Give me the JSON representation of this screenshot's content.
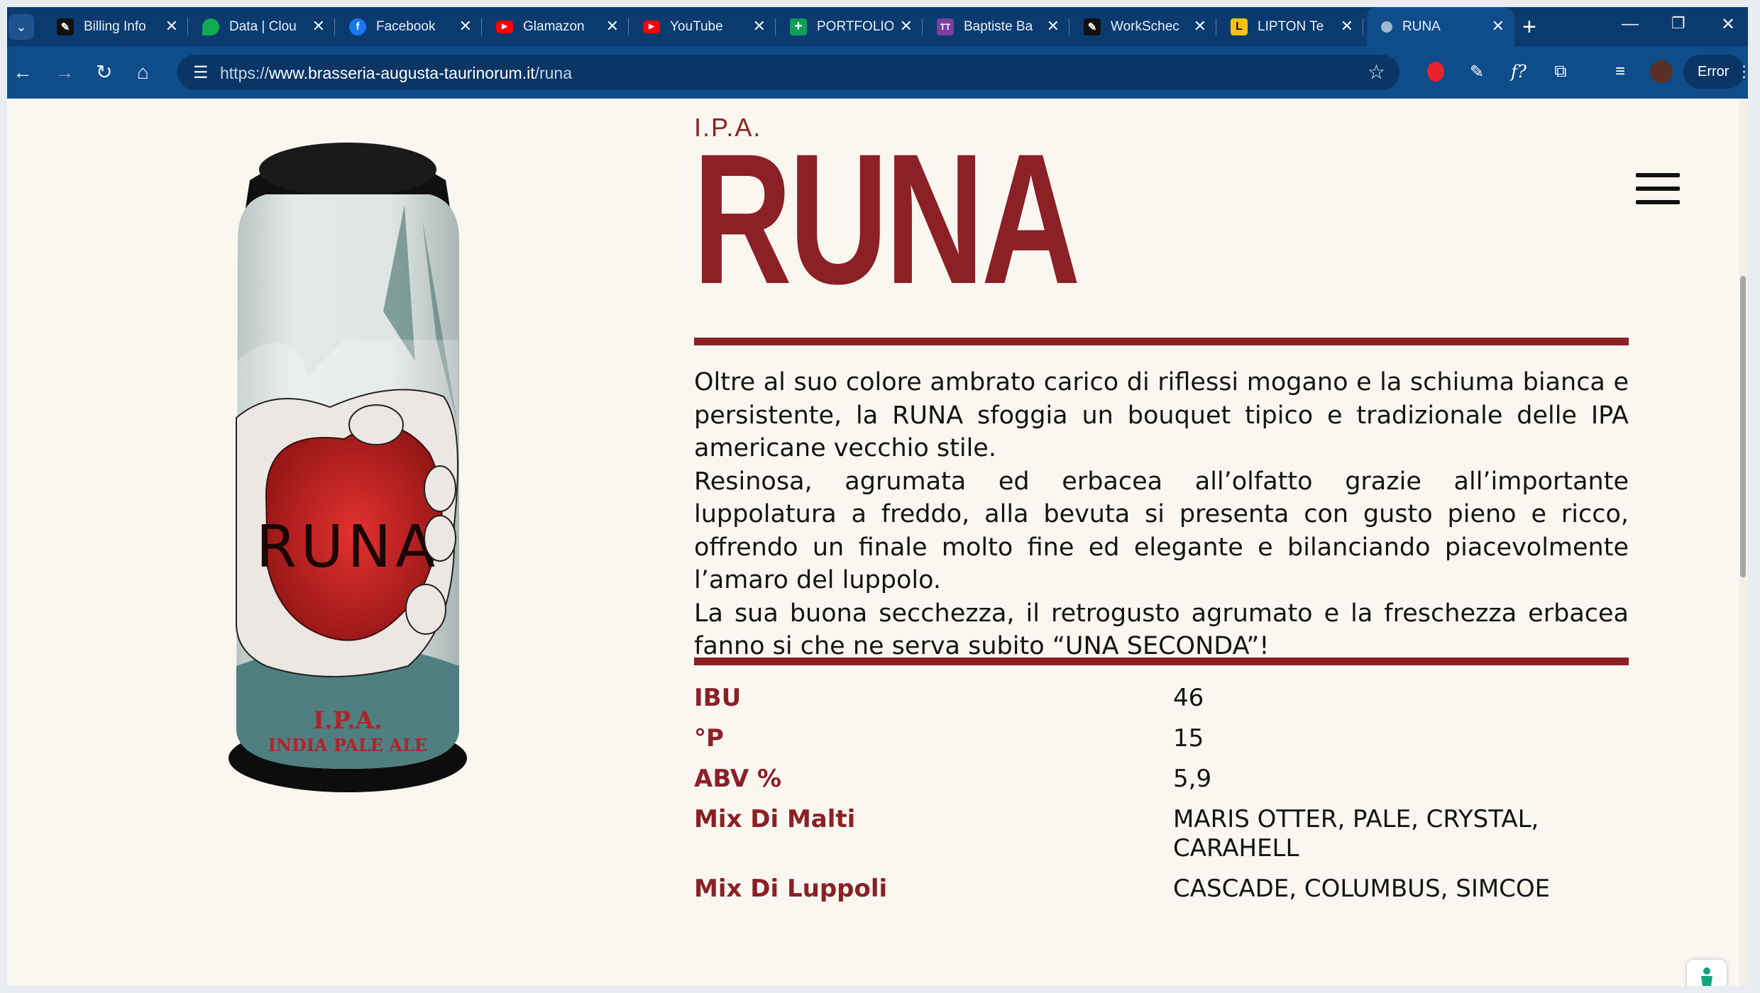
{
  "browser": {
    "tabs": [
      {
        "label": "Billing Info",
        "icon": "squarespace-icon",
        "color": "#111111"
      },
      {
        "label": "Data | Clou",
        "icon": "mongodb-leaf-icon",
        "color": "#13aa52"
      },
      {
        "label": "Facebook",
        "icon": "facebook-icon",
        "color": "#1877f2"
      },
      {
        "label": "Glamazon",
        "icon": "youtube-icon",
        "color": "#ff0000"
      },
      {
        "label": "YouTube",
        "icon": "youtube-icon",
        "color": "#ff0000"
      },
      {
        "label": "PORTFOLIO",
        "icon": "sheets-icon",
        "color": "#0f9d58"
      },
      {
        "label": "Baptiste Ba",
        "icon": "tt-icon",
        "color": "#7b3fa0"
      },
      {
        "label": "WorkSchec",
        "icon": "squarespace-icon",
        "color": "#111111"
      },
      {
        "label": "LIPTON Te",
        "icon": "lipton-icon",
        "color": "#f4c20d"
      },
      {
        "label": "RUNA",
        "icon": "site-icon",
        "color": "#9fb6d1",
        "active": true
      }
    ],
    "url_prefix": "https://",
    "url_host": "www.brasseria-augusta-taurinorum.it",
    "url_path": "/runa",
    "error_label": "Error"
  },
  "page": {
    "type_label": "I.P.A.",
    "beer_name": "RUNA",
    "description": [
      "Oltre al suo colore ambrato carico di riflessi mogano e la schiuma bianca e persistente, la RUNA sfoggia un bouquet tipico e tradizionale delle IPA americane vecchio stile.",
      "Resinosa, agrumata ed erbacea all’olfatto grazie all’importante luppolatura a freddo, alla bevuta si presenta con gusto pieno e ricco, offrendo un finale molto fine ed elegante e bilanciando piacevolmente l’amaro del luppolo.",
      "La sua buona secchezza, il retrogusto agrumato e la freschezza erbacea fanno si che ne serva subito “UNA SECONDA”!"
    ],
    "specs": [
      {
        "label": "IBU",
        "value": "46"
      },
      {
        "label": "°P",
        "value": "15"
      },
      {
        "label": "ABV %",
        "value": "5,9"
      },
      {
        "label": "Mix Di Malti",
        "value": "MARIS OTTER, PALE, CRYSTAL, CARAHELL"
      },
      {
        "label": "Mix Di Luppoli",
        "value": "CASCADE, COLUMBUS, SIMCOE"
      }
    ],
    "can_label": {
      "name": "RUNA",
      "style": "I.P.A.",
      "subtitle": "INDIA PALE ALE"
    },
    "accent_color": "#8b2026"
  }
}
